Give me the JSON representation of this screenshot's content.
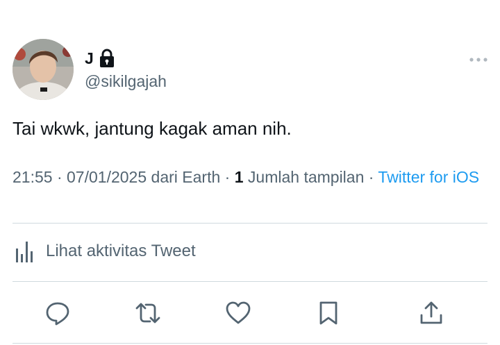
{
  "tweet": {
    "display_name": "J",
    "handle": "@sikilgajah",
    "text": "Tai wkwk, jantung kagak aman nih.",
    "time": "21:55",
    "date": "07/01/2025",
    "location_prefix": "dari",
    "location": "Earth",
    "view_count": "1",
    "view_label": "Jumlah tampilan",
    "source": "Twitter for iOS",
    "separator": "·"
  },
  "activity": {
    "label": "Lihat aktivitas Tweet"
  },
  "icons": {
    "lock": "lock-icon",
    "more": "more-dots-icon",
    "activity": "bar-chart-icon",
    "reply": "reply-icon",
    "retweet": "retweet-icon",
    "like": "heart-icon",
    "bookmark": "bookmark-icon",
    "share": "share-icon"
  },
  "colors": {
    "text_primary": "#0f1419",
    "text_secondary": "#536471",
    "link": "#1d9bf0",
    "divider": "#cfd9de"
  }
}
